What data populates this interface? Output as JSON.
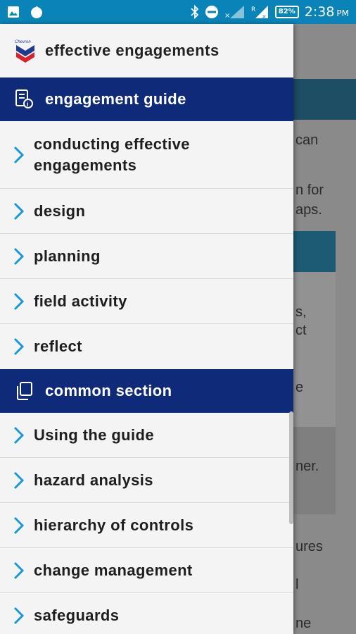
{
  "status_bar": {
    "time": "2:38",
    "ampm": "PM",
    "battery": "82"
  },
  "background_text": [
    "can",
    "n for",
    "aps.",
    "s,",
    "ct",
    "e",
    "ner.",
    "ures",
    "l",
    "ne"
  ],
  "drawer": {
    "logo_text": "Chevron",
    "title": "effective engagements",
    "sections": [
      {
        "label": "engagement guide",
        "icon": "document-icon",
        "items": [
          {
            "label": "conducting effective engagements"
          },
          {
            "label": "design"
          },
          {
            "label": "planning"
          },
          {
            "label": "field activity"
          },
          {
            "label": "reflect"
          }
        ]
      },
      {
        "label": "common section",
        "icon": "copy-icon",
        "items": [
          {
            "label": "Using the guide"
          },
          {
            "label": "hazard analysis"
          },
          {
            "label": "hierarchy of controls"
          },
          {
            "label": "change management"
          },
          {
            "label": "safeguards"
          }
        ]
      }
    ]
  },
  "colors": {
    "status_bar": "#0a84b8",
    "section_header": "#0f2a78",
    "chevron": "#1a9bd7",
    "drawer_bg": "#f4f4f4"
  }
}
